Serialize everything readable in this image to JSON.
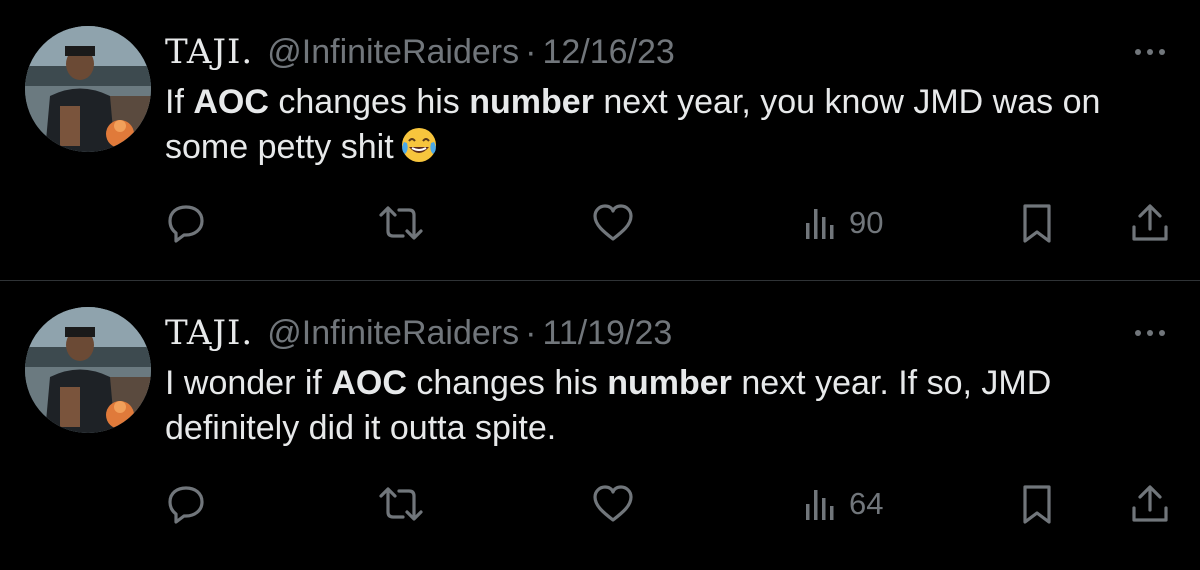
{
  "tweets": [
    {
      "display_name": "TAJI.",
      "handle": "@InfiniteRaiders",
      "separator": "·",
      "date": "12/16/23",
      "text_parts": [
        {
          "t": "If ",
          "bold": false
        },
        {
          "t": "AOC",
          "bold": true
        },
        {
          "t": " changes his ",
          "bold": false
        },
        {
          "t": "number",
          "bold": true
        },
        {
          "t": " next year, you know JMD was on some petty shit",
          "bold": false
        }
      ],
      "emoji": "face-with-tears-of-joy-icon",
      "views": "90"
    },
    {
      "display_name": "TAJI.",
      "handle": "@InfiniteRaiders",
      "separator": "·",
      "date": "11/19/23",
      "text_parts": [
        {
          "t": "I wonder if ",
          "bold": false
        },
        {
          "t": "AOC",
          "bold": true
        },
        {
          "t": " changes his ",
          "bold": false
        },
        {
          "t": "number",
          "bold": true
        },
        {
          "t": " next year. If so, JMD definitely did it outta spite.",
          "bold": false
        }
      ],
      "emoji": null,
      "views": "64"
    }
  ],
  "icons": {
    "reply": "reply-icon",
    "retweet": "retweet-icon",
    "like": "heart-icon",
    "views": "views-bar-chart-icon",
    "bookmark": "bookmark-icon",
    "share": "share-icon",
    "more": "more-dots-icon"
  },
  "colors": {
    "background": "#000000",
    "primary_text": "#e7e9ea",
    "secondary_text": "#71767b",
    "divider": "#2f3336"
  }
}
